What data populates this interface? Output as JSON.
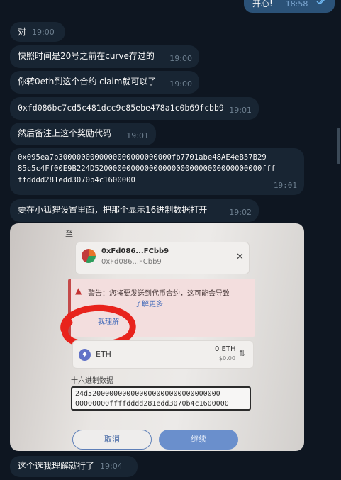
{
  "outgoing": {
    "text": "开心!",
    "time": "18:58"
  },
  "messages": [
    {
      "text": "对",
      "time": "19:00"
    },
    {
      "text": "快照时间是20号之前在curve存过的",
      "time": "19:00"
    },
    {
      "text": "你转0eth到这个合约 claim就可以了",
      "time": "19:00"
    },
    {
      "text": "0xfd086bc7cd5c481dcc9c85ebe478a1c0b69fcbb9",
      "time": "19:01"
    },
    {
      "text": "然后备注上这个奖励代码",
      "time": "19:01"
    },
    {
      "line1": "0x095ea7b3000000000000000000000000fb7701abe48AE4eB57B29",
      "line2": "85c5c4Ff00E9B224D5200000000000000000000000000000000000fff",
      "line3": "ffdddd281edd3070b4c1600000",
      "time": "19:01"
    },
    {
      "text": "要在小狐狸设置里面，把那个显示16进制数据打开",
      "time": "19:02"
    },
    {
      "text": "这个选我理解就行了",
      "time": "19:04"
    }
  ],
  "photo": {
    "to_label": "至",
    "contract_short": "0xFd086...FCbb9",
    "contract_short_sub": "0xFd086...FCbb9",
    "warning_text": "警告：您将要发送到代币合约，这可能会导致",
    "learn_more": "了解更多",
    "understand": "我理解",
    "token": "ETH",
    "amount": "0 ETH",
    "amount_usd": "$0.00",
    "hex_label": "十六进制数据",
    "hex_line1": "24d5200000000000000000000000000000",
    "hex_line2": "00000000ffffdddd281edd3070b4c1600000",
    "cancel": "取消",
    "confirm": "继续"
  }
}
